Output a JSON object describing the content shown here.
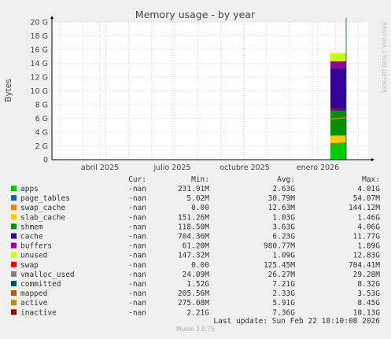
{
  "chart_data": {
    "type": "area",
    "title": "Memory usage - by year",
    "ylabel": "Bytes",
    "ylim": [
      0,
      20
    ],
    "y_ticks": [
      "0",
      "2 G",
      "4 G",
      "6 G",
      "8 G",
      "10 G",
      "12 G",
      "14 G",
      "16 G",
      "18 G",
      "20 G"
    ],
    "x_ticks": [
      "abril 2025",
      "julio 2025",
      "octubre 2025",
      "enero 2026"
    ],
    "grid": true,
    "side_text": "RRDTOOL / TOBI OETIKER",
    "series_note": "data present only from roughly late January to February 2026; stacked areas ending near 15.8 G",
    "columns": [
      "Cur:",
      "Min:",
      "Avg:",
      "Max:"
    ],
    "series": [
      {
        "name": "apps",
        "color": "#00cc00",
        "cur": "-nan",
        "min": "231.91M",
        "avg": "2.63G",
        "max": "4.01G"
      },
      {
        "name": "page_tables",
        "color": "#0066b3",
        "cur": "-nan",
        "min": "5.02M",
        "avg": "30.79M",
        "max": "54.07M"
      },
      {
        "name": "swap_cache",
        "color": "#ff8000",
        "cur": "-nan",
        "min": "0.00",
        "avg": "12.63M",
        "max": "144.12M"
      },
      {
        "name": "slab_cache",
        "color": "#ffcc00",
        "cur": "-nan",
        "min": "151.26M",
        "avg": "1.03G",
        "max": "1.46G"
      },
      {
        "name": "shmem",
        "color": "#008f00",
        "cur": "-nan",
        "min": "118.50M",
        "avg": "3.63G",
        "max": "4.06G"
      },
      {
        "name": "cache",
        "color": "#330099",
        "cur": "-nan",
        "min": "704.36M",
        "avg": "6.23G",
        "max": "11.77G"
      },
      {
        "name": "buffers",
        "color": "#990099",
        "cur": "-nan",
        "min": "61.20M",
        "avg": "980.77M",
        "max": "1.89G"
      },
      {
        "name": "unused",
        "color": "#ccff00",
        "cur": "-nan",
        "min": "147.32M",
        "avg": "1.09G",
        "max": "12.83G"
      },
      {
        "name": "swap",
        "color": "#ff0000",
        "cur": "-nan",
        "min": "0.00",
        "avg": "125.45M",
        "max": "704.41M"
      },
      {
        "name": "vmalloc_used",
        "color": "#808080",
        "cur": "-nan",
        "min": "24.09M",
        "avg": "26.27M",
        "max": "29.28M"
      },
      {
        "name": "committed",
        "color": "#004d66",
        "cur": "-nan",
        "min": "1.52G",
        "avg": "7.21G",
        "max": "8.32G"
      },
      {
        "name": "mapped",
        "color": "#b35900",
        "cur": "-nan",
        "min": "205.56M",
        "avg": "2.33G",
        "max": "3.53G"
      },
      {
        "name": "active",
        "color": "#b38f00",
        "cur": "-nan",
        "min": "275.08M",
        "avg": "5.91G",
        "max": "8.45G"
      },
      {
        "name": "inactive",
        "color": "#990000",
        "cur": "-nan",
        "min": "2.21G",
        "avg": "7.36G",
        "max": "10.13G"
      }
    ],
    "last_update": "Last update: Sun Feb 22 18:10:08 2026"
  },
  "footer": "Munin 2.0.75"
}
